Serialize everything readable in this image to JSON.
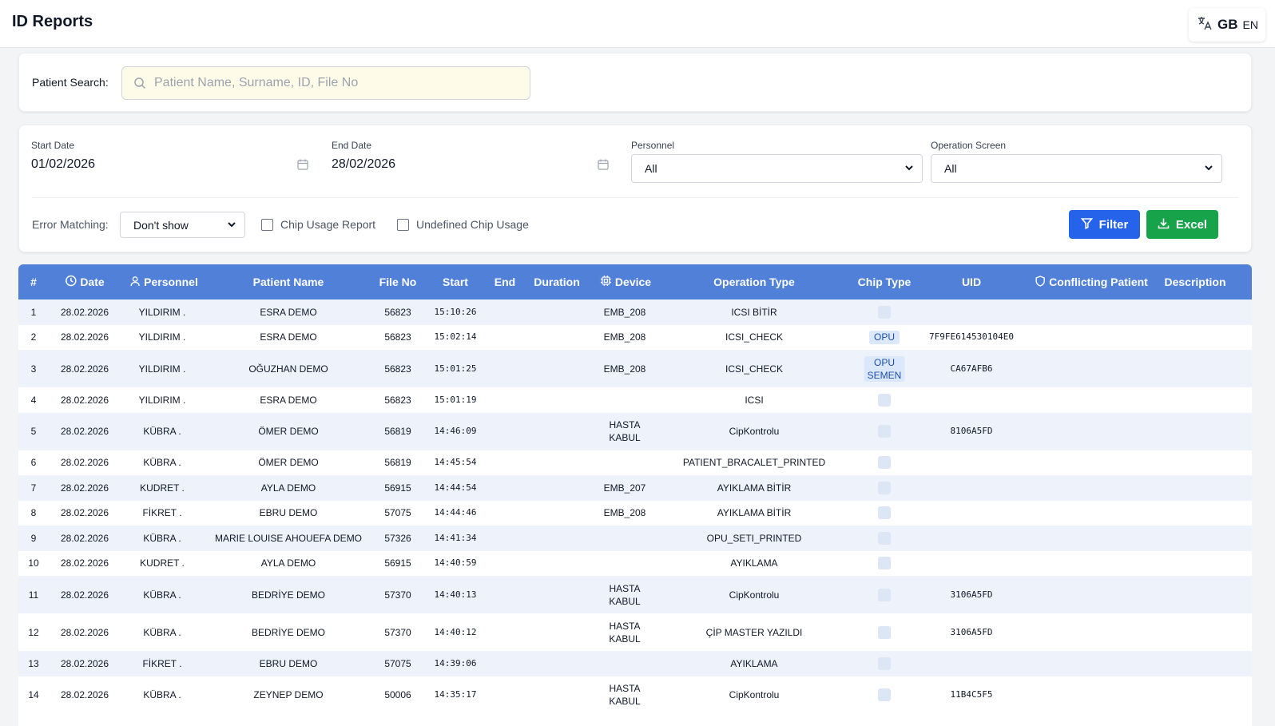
{
  "header": {
    "title": "ID Reports",
    "lang_flag": "GB",
    "lang_code": "EN"
  },
  "search": {
    "label": "Patient Search:",
    "placeholder": "Patient Name, Surname, ID, File No",
    "value": ""
  },
  "filters": {
    "start_date": {
      "label": "Start Date",
      "value": "01/02/2026"
    },
    "end_date": {
      "label": "End Date",
      "value": "28/02/2026"
    },
    "personnel": {
      "label": "Personnel",
      "value": "All"
    },
    "operation_screen": {
      "label": "Operation Screen",
      "value": "All"
    },
    "error_matching": {
      "label": "Error Matching:",
      "value": "Don't show"
    },
    "chip_usage_report": {
      "label": "Chip Usage Report",
      "checked": false
    },
    "undefined_chip_usage": {
      "label": "Undefined Chip Usage",
      "checked": false
    },
    "filter_button": "Filter",
    "excel_button": "Excel"
  },
  "table": {
    "headers": {
      "index": "#",
      "date": "Date",
      "personnel": "Personnel",
      "patient_name": "Patient Name",
      "file_no": "File No",
      "start": "Start",
      "end": "End",
      "duration": "Duration",
      "device": "Device",
      "operation_type": "Operation Type",
      "chip_type": "Chip Type",
      "uid": "UID",
      "conflicting_patient": "Conflicting Patient",
      "description": "Description"
    },
    "rows": [
      {
        "n": "1",
        "date": "28.02.2026",
        "personnel": "YILDIRIM .",
        "patient": "ESRA DEMO",
        "file": "56823",
        "start": "15:10:26",
        "device": "EMB_208",
        "op": "ICSI BİTİR",
        "chip": [],
        "uid": ""
      },
      {
        "n": "2",
        "date": "28.02.2026",
        "personnel": "YILDIRIM .",
        "patient": "ESRA DEMO",
        "file": "56823",
        "start": "15:02:14",
        "device": "EMB_208",
        "op": "ICSI_CHECK",
        "chip": [
          "OPU"
        ],
        "uid": "7F9FE614530104E0"
      },
      {
        "n": "3",
        "date": "28.02.2026",
        "personnel": "YILDIRIM .",
        "patient": "OĞUZHAN DEMO",
        "file": "56823",
        "start": "15:01:25",
        "device": "EMB_208",
        "op": "ICSI_CHECK",
        "chip": [
          "OPU",
          "SEMEN"
        ],
        "uid": "CA67AFB6"
      },
      {
        "n": "4",
        "date": "28.02.2026",
        "personnel": "YILDIRIM .",
        "patient": "ESRA DEMO",
        "file": "56823",
        "start": "15:01:19",
        "device": "",
        "op": "ICSI",
        "chip": [],
        "uid": ""
      },
      {
        "n": "5",
        "date": "28.02.2026",
        "personnel": "KÜBRA .",
        "patient": "ÖMER DEMO",
        "file": "56819",
        "start": "14:46:09",
        "device": "HASTA KABUL",
        "op": "CipKontrolu",
        "chip": [],
        "uid": "8106A5FD"
      },
      {
        "n": "6",
        "date": "28.02.2026",
        "personnel": "KÜBRA .",
        "patient": "ÖMER DEMO",
        "file": "56819",
        "start": "14:45:54",
        "device": "",
        "op": "PATIENT_BRACALET_PRINTED",
        "chip": [],
        "uid": ""
      },
      {
        "n": "7",
        "date": "28.02.2026",
        "personnel": "KUDRET .",
        "patient": "AYLA DEMO",
        "file": "56915",
        "start": "14:44:54",
        "device": "EMB_207",
        "op": "AYIKLAMA BİTİR",
        "chip": [],
        "uid": ""
      },
      {
        "n": "8",
        "date": "28.02.2026",
        "personnel": "FİKRET .",
        "patient": "EBRU DEMO",
        "file": "57075",
        "start": "14:44:46",
        "device": "EMB_208",
        "op": "AYIKLAMA BİTİR",
        "chip": [],
        "uid": ""
      },
      {
        "n": "9",
        "date": "28.02.2026",
        "personnel": "KÜBRA .",
        "patient": "MARIE LOUISE AHOUEFA DEMO",
        "file": "57326",
        "start": "14:41:34",
        "device": "",
        "op": "OPU_SETI_PRINTED",
        "chip": [],
        "uid": ""
      },
      {
        "n": "10",
        "date": "28.02.2026",
        "personnel": "KUDRET .",
        "patient": "AYLA DEMO",
        "file": "56915",
        "start": "14:40:59",
        "device": "",
        "op": "AYIKLAMA",
        "chip": [],
        "uid": ""
      },
      {
        "n": "11",
        "date": "28.02.2026",
        "personnel": "KÜBRA .",
        "patient": "BEDRİYE DEMO",
        "file": "57370",
        "start": "14:40:13",
        "device": "HASTA KABUL",
        "op": "CipKontrolu",
        "chip": [],
        "uid": "3106A5FD"
      },
      {
        "n": "12",
        "date": "28.02.2026",
        "personnel": "KÜBRA .",
        "patient": "BEDRİYE DEMO",
        "file": "57370",
        "start": "14:40:12",
        "device": "HASTA KABUL",
        "op": "ÇİP MASTER YAZILDI",
        "chip": [],
        "uid": "3106A5FD"
      },
      {
        "n": "13",
        "date": "28.02.2026",
        "personnel": "FİKRET .",
        "patient": "EBRU DEMO",
        "file": "57075",
        "start": "14:39:06",
        "device": "",
        "op": "AYIKLAMA",
        "chip": [],
        "uid": ""
      },
      {
        "n": "14",
        "date": "28.02.2026",
        "personnel": "KÜBRA .",
        "patient": "ZEYNEP DEMO",
        "file": "50006",
        "start": "14:35:17",
        "device": "HASTA KABUL",
        "op": "CipKontrolu",
        "chip": [],
        "uid": "11B4C5F5"
      }
    ]
  },
  "icons": [
    "translate-icon",
    "search-icon",
    "calendar-icon",
    "chevron-down-icon",
    "filter-icon",
    "download-icon",
    "clock-icon",
    "user-icon",
    "chip-icon",
    "shield-icon"
  ]
}
